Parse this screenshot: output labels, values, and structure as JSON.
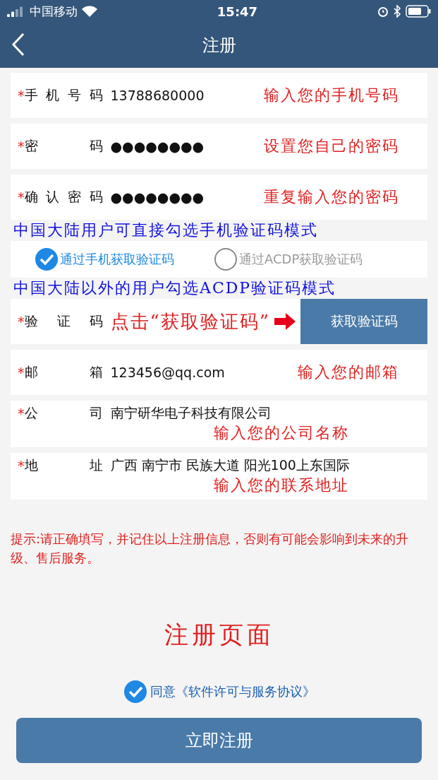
{
  "status_bar": {
    "carrier": "中国移动",
    "time": "15:47"
  },
  "nav": {
    "title": "注册"
  },
  "form": [
    {
      "kind": "field",
      "required_mark": "*",
      "label": "手 机 号 码",
      "value": "13788680000",
      "annotation": "输入您的手机号码"
    },
    {
      "kind": "field",
      "required_mark": "*",
      "label": "密 码",
      "value": "●●●●●●●●",
      "annotation": "设置您自己的密码"
    },
    {
      "kind": "field",
      "required_mark": "*",
      "label": "确 认 密 码",
      "value": "●●●●●●●●",
      "annotation": "重复输入您的密码"
    },
    {
      "kind": "note",
      "text": "中国大陆用户可直接勾选手机验证码模式"
    },
    {
      "kind": "radio",
      "options": [
        {
          "label": "通过手机获取验证码",
          "selected": true
        },
        {
          "label": "通过ACDP获取验证码",
          "selected": false
        }
      ]
    },
    {
      "kind": "note",
      "text": "中国大陆以外的用户勾选ACDP验证码模式"
    },
    {
      "kind": "code",
      "required_mark": "*",
      "label": "验 证 码",
      "annotation": "点击“获取验证码”",
      "button": "获取验证码"
    },
    {
      "kind": "field",
      "required_mark": "*",
      "label": "邮 箱",
      "value": "123456@qq.com",
      "annotation": "输入您的邮箱"
    },
    {
      "kind": "stacked_field",
      "required_mark": "*",
      "label": "公 司",
      "value": "南宁研华电子科技有限公司",
      "annotation": "输入您的公司名称"
    },
    {
      "kind": "stacked_field",
      "required_mark": "*",
      "label": "地 址",
      "value": "广西 南宁市 民族大道 阳光100上东国际",
      "annotation": "输入您的联系地址"
    }
  ],
  "tip": "提示:请正确填写，并记住以上注册信息，否则有可能会影响到未来的升级、售后服务。",
  "page_caption": "注册页面",
  "agreement": {
    "checked": true,
    "text": "同意《软件许可与服务协议》"
  },
  "submit": "立即注册"
}
